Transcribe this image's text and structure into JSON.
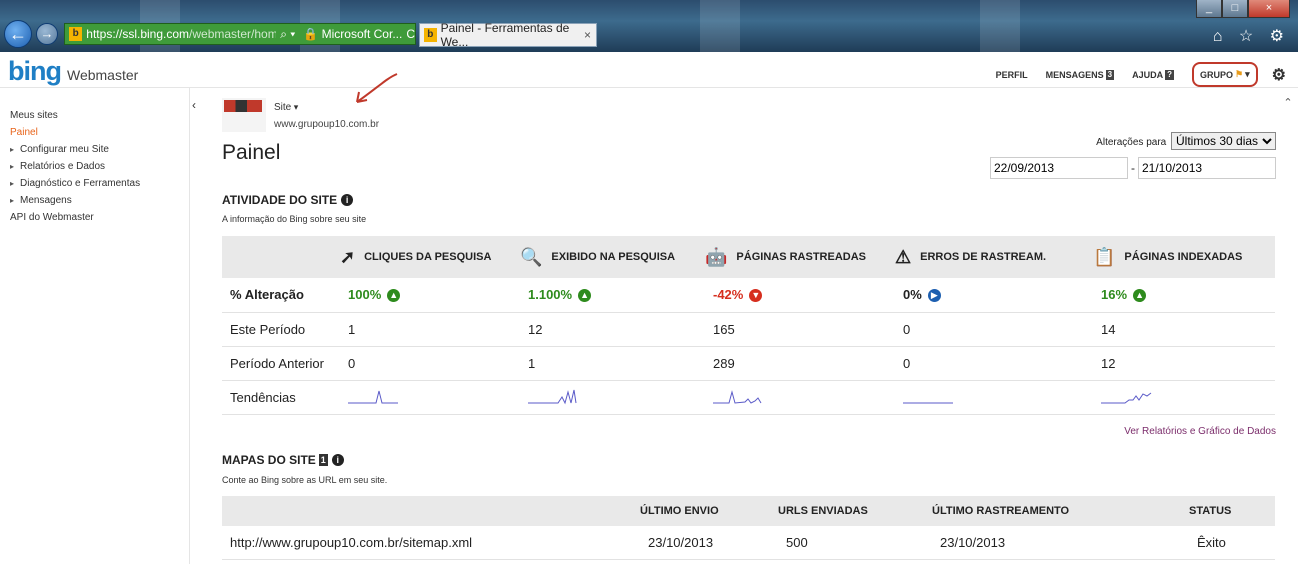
{
  "browser": {
    "address_url_host": "https://ssl.bing.com",
    "address_url_path": "/webmaster/hom",
    "address_tools": "⌕ ▾",
    "cert_label": "🔒 Microsoft Cor...",
    "refresh_icon": "C",
    "tab_title": "Painel - Ferramentas de We...",
    "tab_close": "×",
    "window_controls": [
      "_",
      "□",
      "×"
    ],
    "toolbar_icons": "⌂ ☆ ⚙"
  },
  "header": {
    "logo": "bing",
    "product": "Webmaster",
    "nav": [
      "PERFIL",
      "MENSAGENS",
      "AJUDA",
      "GRUPO"
    ],
    "messages_badge": "3",
    "help_badge": "?"
  },
  "sidebar": {
    "items": [
      {
        "label": "Meus sites"
      },
      {
        "label": "Painel"
      },
      {
        "label": "Configurar meu Site"
      },
      {
        "label": "Relatórios e Dados"
      },
      {
        "label": "Diagnóstico e Ferramentas"
      },
      {
        "label": "Mensagens"
      },
      {
        "label": "API do Webmaster"
      }
    ]
  },
  "site": {
    "selector_label": "Site",
    "domain": "www.grupoup10.com.br"
  },
  "page": {
    "title": "Painel",
    "range_label": "Alterações para",
    "range_value": "Últimos 30 dias",
    "date_from": "22/09/2013",
    "date_sep": "-",
    "date_to": "21/10/2013"
  },
  "activity": {
    "title": "ATIVIDADE DO SITE",
    "subtitle": "A informação do Bing sobre seu site",
    "columns": [
      {
        "label": "CLIQUES DA PESQUISA",
        "icon": "pointer-icon"
      },
      {
        "label": "EXIBIDO NA PESQUISA",
        "icon": "magnifier-icon"
      },
      {
        "label": "PÁGINAS RASTREADAS",
        "icon": "robot-icon"
      },
      {
        "label": "ERROS DE RASTREAM.",
        "icon": "warning-icon"
      },
      {
        "label": "PÁGINAS INDEXADAS",
        "icon": "document-icon"
      }
    ],
    "rows": {
      "change_label": "% Alteração",
      "change": [
        "100%",
        "1.100%",
        "-42%",
        "0%",
        "16%"
      ],
      "change_dir": [
        "up",
        "up",
        "down",
        "right",
        "up"
      ],
      "this_label": "Este Período",
      "this": [
        "1",
        "12",
        "165",
        "0",
        "14"
      ],
      "prev_label": "Período Anterior",
      "prev": [
        "0",
        "1",
        "289",
        "0",
        "12"
      ],
      "trend_label": "Tendências"
    },
    "report_link": "Ver Relatórios e Gráfico de Dados"
  },
  "sitemaps": {
    "title": "MAPAS DO SITE",
    "count": "1",
    "subtitle": "Conte ao Bing sobre as URL em seu site.",
    "headers": [
      "ÚLTIMO ENVIO",
      "URLS ENVIADAS",
      "ÚLTIMO RASTREAMENTO",
      "STATUS"
    ],
    "rows": [
      {
        "url": "http://www.grupoup10.com.br/sitemap.xml",
        "last_sent": "23/10/2013",
        "urls": "500",
        "last_crawl": "23/10/2013",
        "status": "Êxito"
      }
    ]
  },
  "colors": {
    "bing_blue": "#1f7fc5",
    "active_orange": "#e8641b",
    "positive": "#2e8b1d",
    "negative": "#d62e1e",
    "neutral_arrow": "#1d5fb0",
    "annotation_red": "#c0392b"
  }
}
